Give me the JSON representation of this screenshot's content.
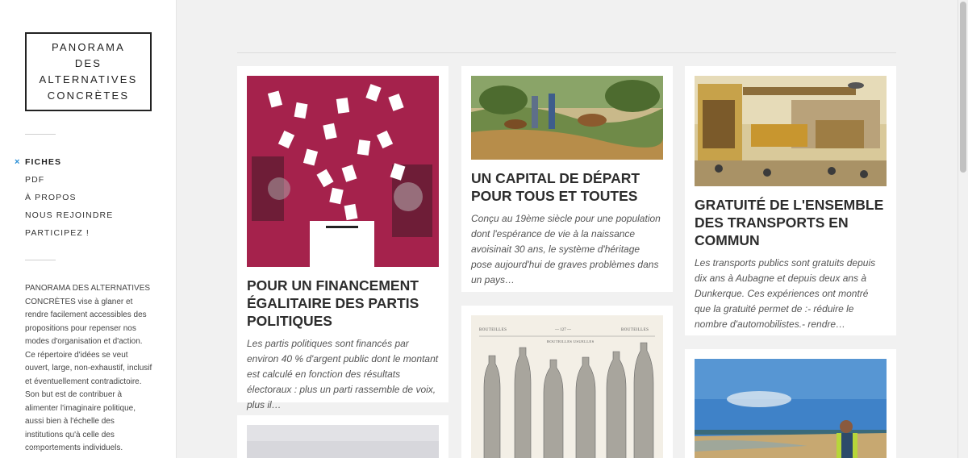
{
  "sidebar": {
    "logo": [
      "PANORAMA",
      "DES",
      "ALTERNATIVES",
      "CONCRÈTES"
    ],
    "nav": [
      {
        "label": "FICHES",
        "active": true
      },
      {
        "label": "PDF"
      },
      {
        "label": "À PROPOS"
      },
      {
        "label": "NOUS REJOINDRE"
      },
      {
        "label": "PARTICIPEZ !"
      }
    ],
    "active_marker": "×",
    "about": "PANORAMA DES ALTERNATIVES CONCRÈTES vise à glaner et rendre facilement accessibles des propositions pour repenser nos modes d'organisation et d'action. Ce répertoire d'idées se veut ouvert, large, non-exhaustif, inclusif et éventuellement contradictoire. Son but est de contribuer à alimenter l'imaginaire politique, aussi bien à l'échelle des institutions qu'à celle des comportements individuels."
  },
  "cards": [
    {
      "title": "POUR UN FINANCEMENT ÉGALITAIRE DES PARTIS POLITIQUES",
      "excerpt": "Les partis politiques sont financés par environ 40 % d'argent public dont le montant est calculé en fonction des résultats électoraux : plus un parti rassemble de voix, plus il…",
      "image": "ballot-box-illustration"
    },
    {
      "title": "UN CAPITAL DE DÉPART POUR TOUS ET TOUTES",
      "excerpt": "Conçu au 19ème siècle pour une population dont l'espérance de vie à la naissance avoisinait 30 ans, le système d'héritage pose aujourd'hui de graves problèmes dans un pays…",
      "image": "hunting-scene-illustration"
    },
    {
      "title": "GRATUITÉ DE L'ENSEMBLE DES TRANSPORTS EN COMMUN",
      "excerpt": "Les transports publics sont gratuits depuis dix ans à Aubagne et depuis deux ans à Dunkerque. Ces expériences ont montré que la gratuité permet de :- réduire le nombre d'automobilistes.- rendre…",
      "image": "futuristic-city-illustration"
    },
    {
      "image": "grey-photo"
    },
    {
      "image": "bottles-engraving",
      "caption_left": "BOUTEILLES",
      "caption_center": "— 127 —",
      "caption_right": "BOUTEILLES",
      "caption_sub": "BOUTEILLES USUELLES"
    },
    {
      "image": "beach-photo"
    }
  ],
  "colors": {
    "accent": "#2a8fd6",
    "ballot_pink": "#d3245d"
  }
}
